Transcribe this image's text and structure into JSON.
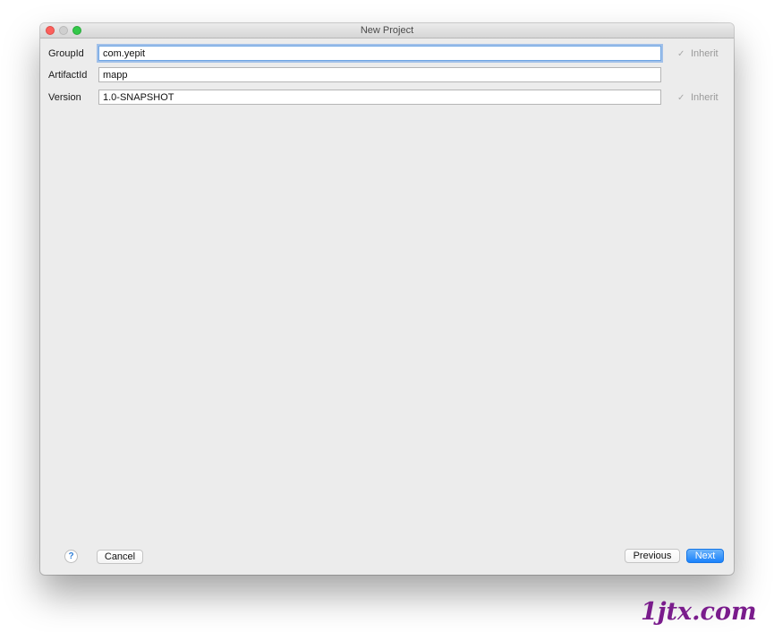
{
  "window": {
    "title": "New Project"
  },
  "form": {
    "group_id": {
      "label": "GroupId",
      "value": "com.yepit",
      "inherit_checked": true,
      "inherit_label": "Inherit"
    },
    "artifact_id": {
      "label": "ArtifactId",
      "value": "mapp"
    },
    "version": {
      "label": "Version",
      "value": "1.0-SNAPSHOT",
      "inherit_checked": true,
      "inherit_label": "Inherit"
    }
  },
  "footer": {
    "help_label": "?",
    "cancel_label": "Cancel",
    "previous_label": "Previous",
    "next_label": "Next"
  },
  "icons": {
    "checkmark": "✓"
  },
  "colors": {
    "accent": "#1a82fb",
    "focus_ring": "#6fa6e4",
    "window_bg": "#ececec"
  },
  "watermark": "1jtx.com"
}
